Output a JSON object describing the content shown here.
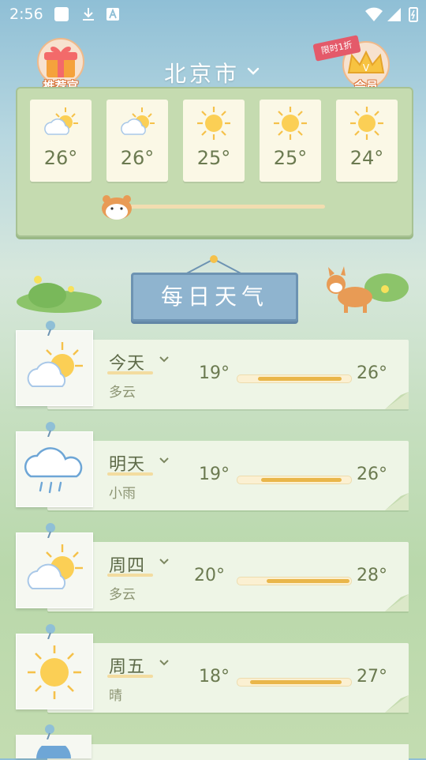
{
  "status_bar": {
    "time": "2:56"
  },
  "header": {
    "city": "北京市",
    "left_badge": {
      "label": "推荐官"
    },
    "right_badge": {
      "promo": "限时1折",
      "label": "会员"
    }
  },
  "hourly": [
    {
      "temp": "26°",
      "icon": "partly-cloudy-icon"
    },
    {
      "temp": "26°",
      "icon": "partly-cloudy-icon"
    },
    {
      "temp": "25°",
      "icon": "sun-icon"
    },
    {
      "temp": "25°",
      "icon": "sun-icon"
    },
    {
      "temp": "24°",
      "icon": "sun-icon"
    }
  ],
  "banner": {
    "title": "每日天气"
  },
  "days": [
    {
      "name": "今天",
      "condition": "多云",
      "low": "19°",
      "high": "26°",
      "icon": "partly-cloudy-icon",
      "range": [
        0.17,
        0.93
      ]
    },
    {
      "name": "明天",
      "condition": "小雨",
      "low": "19°",
      "high": "26°",
      "icon": "rain-cloud-icon",
      "range": [
        0.2,
        0.93
      ]
    },
    {
      "name": "周四",
      "condition": "多云",
      "low": "20°",
      "high": "28°",
      "icon": "partly-cloudy-icon",
      "range": [
        0.25,
        1.0
      ]
    },
    {
      "name": "周五",
      "condition": "晴",
      "low": "18°",
      "high": "27°",
      "icon": "sun-icon",
      "range": [
        0.1,
        0.93
      ]
    }
  ],
  "colors": {
    "accent": "#e9b64a",
    "sign": "#8fb4cf",
    "text": "#6b7a50"
  }
}
